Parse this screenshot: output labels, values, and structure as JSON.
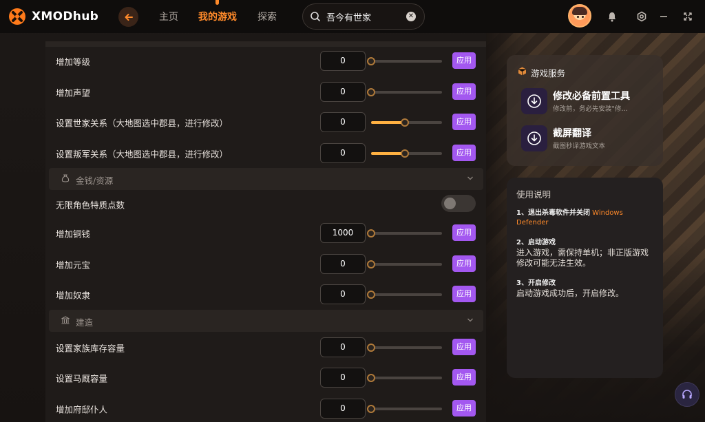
{
  "brand": {
    "name": "XMODhub"
  },
  "nav": {
    "home": "主页",
    "my_games": "我的游戏",
    "explore": "探索"
  },
  "search": {
    "value": "吾今有世家"
  },
  "rows_top": [
    {
      "label": "增加等级",
      "value": "0",
      "slider": 0.0,
      "apply": "应用"
    },
    {
      "label": "增加声望",
      "value": "0",
      "slider": 0.0,
      "apply": "应用"
    },
    {
      "label": "设置世家关系（大地图选中郡县，进行修改）",
      "value": "0",
      "slider": 0.5,
      "apply": "应用"
    },
    {
      "label": "设置叛军关系（大地图选中郡县，进行修改）",
      "value": "0",
      "slider": 0.5,
      "apply": "应用"
    }
  ],
  "section_money": {
    "title": "金钱/资源"
  },
  "toggle_row": {
    "label": "无限角色特质点数",
    "on": false
  },
  "rows_money": [
    {
      "label": "增加铜钱",
      "value": "1000",
      "slider": 0.0,
      "apply": "应用"
    },
    {
      "label": "增加元宝",
      "value": "0",
      "slider": 0.0,
      "apply": "应用"
    },
    {
      "label": "增加奴隶",
      "value": "0",
      "slider": 0.0,
      "apply": "应用"
    }
  ],
  "section_build": {
    "title": "建造"
  },
  "rows_build": [
    {
      "label": "设置家族库存容量",
      "value": "0",
      "slider": 0.0,
      "apply": "应用"
    },
    {
      "label": "设置马厩容量",
      "value": "0",
      "slider": 0.0,
      "apply": "应用"
    },
    {
      "label": "增加府邸仆人",
      "value": "0",
      "slider": 0.0,
      "apply": "应用"
    }
  ],
  "services": {
    "title": "游戏服务",
    "items": [
      {
        "name": "修改必备前置工具",
        "desc": "修改前，务必先安装\"修…"
      },
      {
        "name": "截屏翻译",
        "desc": "截图秒译游戏文本"
      }
    ]
  },
  "guide": {
    "title": "使用说明",
    "step1_title": "1、退出杀毒软件并关闭",
    "step1_highlight": "Windows Defender",
    "step2_title": "2、启动游戏",
    "step2_body": "进入游戏，需保持单机；非正版游戏修改可能无法生效。",
    "step3_title": "3、开启修改",
    "step3_body": "启动游戏成功后，开启修改。"
  },
  "colors": {
    "accent": "#ff8a2a",
    "apply": "#a358f0",
    "slider_fill": "#ffb142"
  }
}
